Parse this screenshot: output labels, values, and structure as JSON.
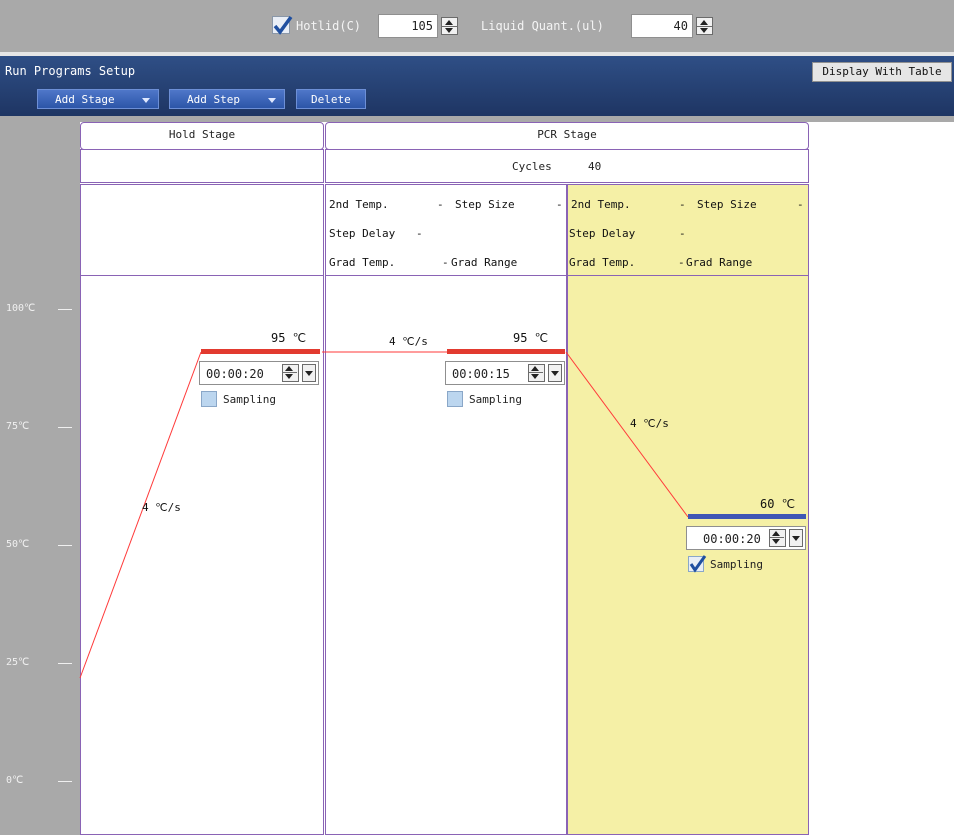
{
  "topbar": {
    "hotlid_label": "Hotlid(C)",
    "hotlid_checked": true,
    "hotlid_value": "105",
    "liquid_label": "Liquid Quant.(ul)",
    "liquid_value": "40"
  },
  "header": {
    "title": "Run Programs Setup",
    "display_with_table": "Display With Table",
    "add_stage": "Add Stage",
    "add_step": "Add Step",
    "delete": "Delete"
  },
  "axis": {
    "ticks": [
      "100℃",
      "75℃",
      "50℃",
      "25℃",
      "0℃"
    ]
  },
  "stages": {
    "hold": {
      "title": "Hold Stage"
    },
    "pcr": {
      "title": "PCR Stage",
      "cycles_label": "Cycles",
      "cycles_value": "40"
    }
  },
  "step_info": {
    "second_temp": "2nd Temp.",
    "dash": "-",
    "step_size": "Step Size",
    "step_delay": "Step Delay",
    "grad_temp": "Grad Temp.",
    "grad_range": "Grad Range"
  },
  "steps": [
    {
      "temp": "95 ℃",
      "temp_value": 95,
      "time": "00:00:20",
      "rate": "4 ℃/s",
      "sampling": "Sampling",
      "sampling_checked": false,
      "bar_color": "#e23a2f"
    },
    {
      "temp": "95 ℃",
      "temp_value": 95,
      "time": "00:00:15",
      "rate": "4 ℃/s",
      "sampling": "Sampling",
      "sampling_checked": false,
      "bar_color": "#e23a2f"
    },
    {
      "temp": "60 ℃",
      "temp_value": 60,
      "time": "00:00:20",
      "rate": "4 ℃/s",
      "sampling": "Sampling",
      "sampling_checked": true,
      "bar_color": "#3f56b5"
    }
  ],
  "colors": {
    "selected_step_bg": "#f5f0a6",
    "stage_border": "#8a63b5",
    "header_blue": "#26417a",
    "ramp_line": "#ff3a3a"
  }
}
